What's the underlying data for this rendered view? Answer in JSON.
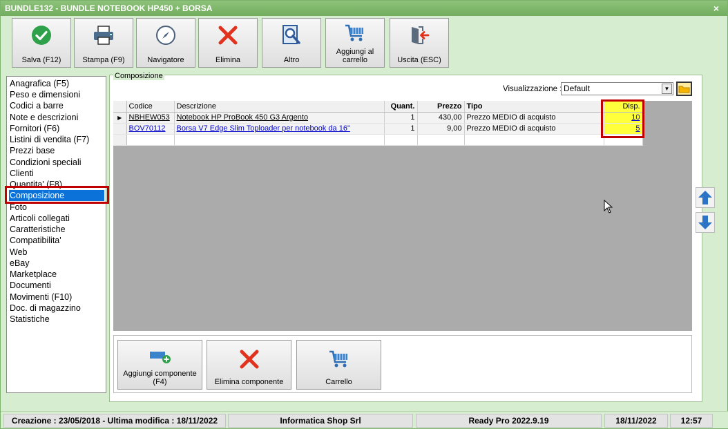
{
  "window": {
    "title": "BUNDLE132 - BUNDLE NOTEBOOK HP450 + BORSA",
    "close_glyph": "×"
  },
  "toolbar": [
    {
      "label": "Salva (F12)",
      "icon": "check-icon"
    },
    {
      "label": "Stampa (F9)",
      "icon": "printer-icon"
    },
    {
      "label": "Navigatore",
      "icon": "compass-icon"
    },
    {
      "label": "Elimina",
      "icon": "delete-x-icon"
    },
    {
      "label": "Altro",
      "icon": "magnifier-icon"
    },
    {
      "label": "Aggiungi al carrello",
      "icon": "cart-icon"
    },
    {
      "label": "Uscita (ESC)",
      "icon": "exit-door-icon"
    }
  ],
  "sidebar": {
    "items": [
      "Anagrafica (F5)",
      "Peso e dimensioni",
      "Codici a barre",
      "Note e descrizioni",
      "Fornitori (F6)",
      "Listini di vendita (F7)",
      "Prezzi base",
      "Condizioni speciali",
      "Clienti",
      "Quantita' (F8)",
      "Composizione",
      "Foto",
      "Articoli collegati",
      "Caratteristiche",
      "Compatibilita'",
      "Web",
      "eBay",
      "Marketplace",
      "Documenti",
      "Movimenti (F10)",
      "Doc. di magazzino",
      "Statistiche"
    ],
    "selected": "Composizione"
  },
  "composition": {
    "group_label": "Composizione",
    "view_label": "Visualizzazione :",
    "view_value": "Default",
    "columns": {
      "codice": "Codice",
      "descrizione": "Descrizione",
      "quant": "Quant.",
      "prezzo": "Prezzo",
      "tipo": "Tipo",
      "disp": "Disp."
    },
    "rows": [
      {
        "codice": "NBHEW053",
        "descrizione": "Notebook HP ProBook 450 G3 Argento",
        "quant": "1",
        "prezzo": "430,00",
        "tipo": "Prezzo MEDIO di acquisto",
        "disp": "10"
      },
      {
        "codice": "BOV70112",
        "descrizione": "Borsa V7 Edge Slim Toploader per notebook da 16\"",
        "quant": "1",
        "prezzo": "9,00",
        "tipo": "Prezzo MEDIO di acquisto",
        "disp": "5"
      }
    ]
  },
  "component_buttons": [
    {
      "label": "Aggiungi componente (F4)",
      "icon": "add-component-icon"
    },
    {
      "label": "Elimina componente",
      "icon": "delete-x-icon"
    },
    {
      "label": "Carrello",
      "icon": "cart-icon"
    }
  ],
  "statusbar": {
    "dates": "Creazione : 23/05/2018 - Ultima modifica : 18/11/2022",
    "company": "Informatica Shop Srl",
    "version": "Ready Pro 2022.9.19",
    "date": "18/11/2022",
    "time": "12:57"
  },
  "colors": {
    "accent": "#0a72d8",
    "highlight": "#ffff3b",
    "frame": "#d7edd0",
    "alert": "#c00000"
  }
}
